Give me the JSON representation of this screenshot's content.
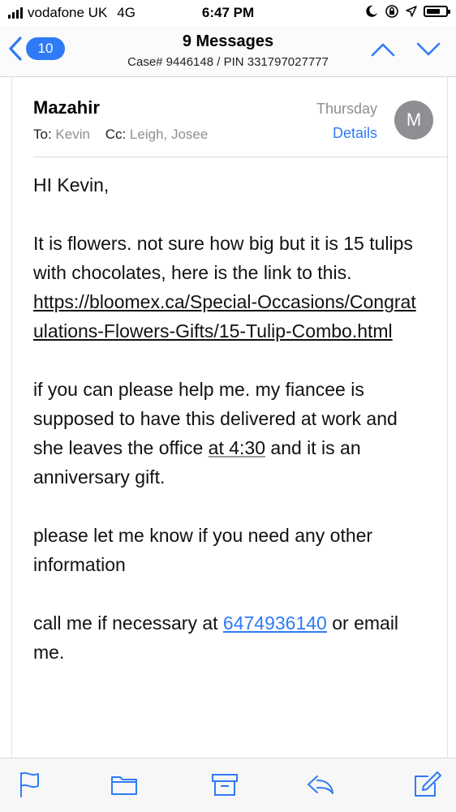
{
  "status_bar": {
    "carrier": "vodafone UK",
    "network": "4G",
    "time": "6:47 PM"
  },
  "nav": {
    "back_count": "10",
    "title": "9 Messages",
    "subtitle": "Case# 9446148 / PIN 331797027777"
  },
  "header": {
    "sender": "Mazahir",
    "to_label": "To:",
    "to_value": "Kevin",
    "cc_label": "Cc:",
    "cc_value": "Leigh, Josee",
    "date": "Thursday",
    "details_label": "Details",
    "avatar_initial": "M"
  },
  "body": {
    "greeting": "HI Kevin,",
    "p1_text": "It is flowers. not sure how big but it is 15 tulips with chocolates,  here is the link to this.",
    "p1_link": "https://bloomex.ca/Special-Occasions/Congratulations-Flowers-Gifts/15-Tulip-Combo.html",
    "p2_before": "if you can please help me. my fiancee is supposed to have this delivered at work and she leaves the office ",
    "p2_time": "at 4:30",
    "p2_after": " and it is an anniversary gift.",
    "p3": "please let me know if you need any other information",
    "p4_before": "call me if necessary at ",
    "p4_phone": "6474936140",
    "p4_after": " or email me."
  },
  "colors": {
    "accent": "#2f7bf5",
    "muted": "#8e8e93"
  },
  "toolbar": {
    "icons": [
      "flag-icon",
      "folder-icon",
      "archive-icon",
      "reply-icon",
      "compose-icon"
    ]
  }
}
